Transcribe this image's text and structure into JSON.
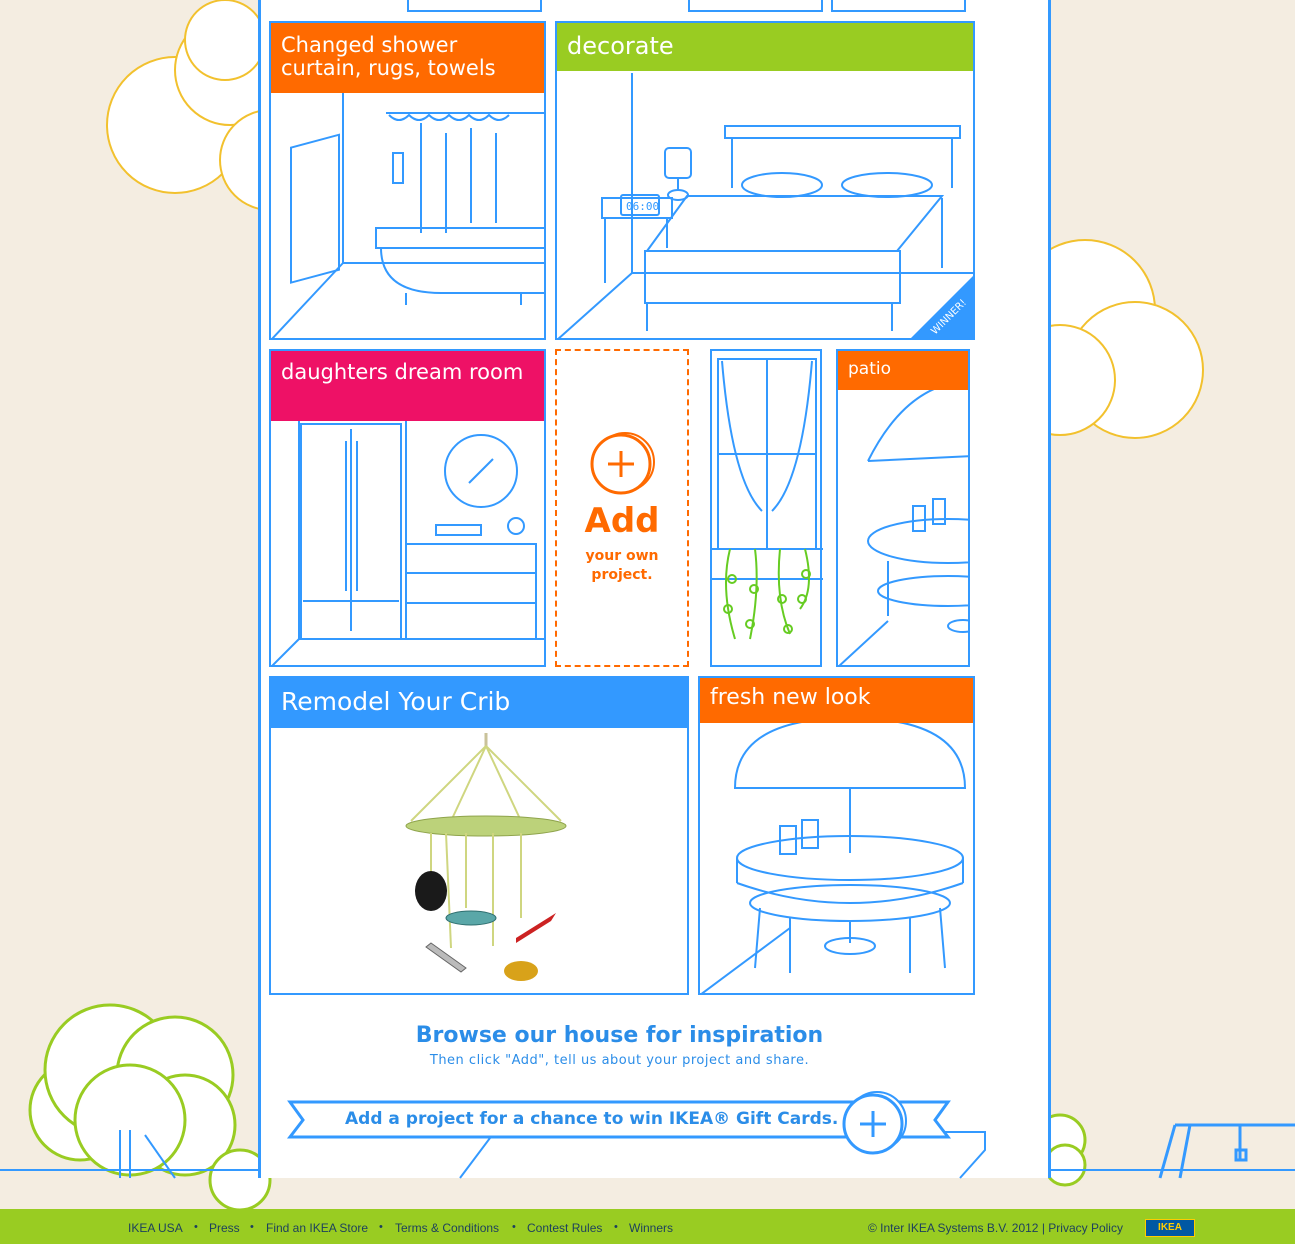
{
  "tiles": {
    "shower": {
      "title": "Changed shower curtain, rugs, towels"
    },
    "decorate": {
      "title": "decorate",
      "badge": "WINNER!",
      "clock": "06:00"
    },
    "daughters": {
      "title": "daughters dream room"
    },
    "patio": {
      "title": "patio"
    },
    "crib": {
      "title": "Remodel Your Crib"
    },
    "fresh": {
      "title": "fresh new look"
    }
  },
  "add_tile": {
    "big": "Add",
    "small": "your own project."
  },
  "browse": {
    "title": "Browse our house for inspiration",
    "subtitle": "Then click \"Add\", tell us about your project and share."
  },
  "cta": {
    "text": "Add a project for a chance to win IKEA® Gift Cards."
  },
  "footer": {
    "links": [
      "IKEA USA",
      "Press",
      "Find an IKEA Store",
      "Terms & Conditions",
      "Contest Rules",
      "Winners"
    ],
    "copyright": "© Inter IKEA Systems B.V. 2012",
    "privacy": "Privacy Policy",
    "logo": "IKEA"
  },
  "colors": {
    "blue": "#3399ff",
    "orange": "#ff6a00",
    "green": "#99cc22",
    "pink": "#ee1166",
    "cloud_outline": "#f2c12e",
    "footer": "#99cc22"
  }
}
